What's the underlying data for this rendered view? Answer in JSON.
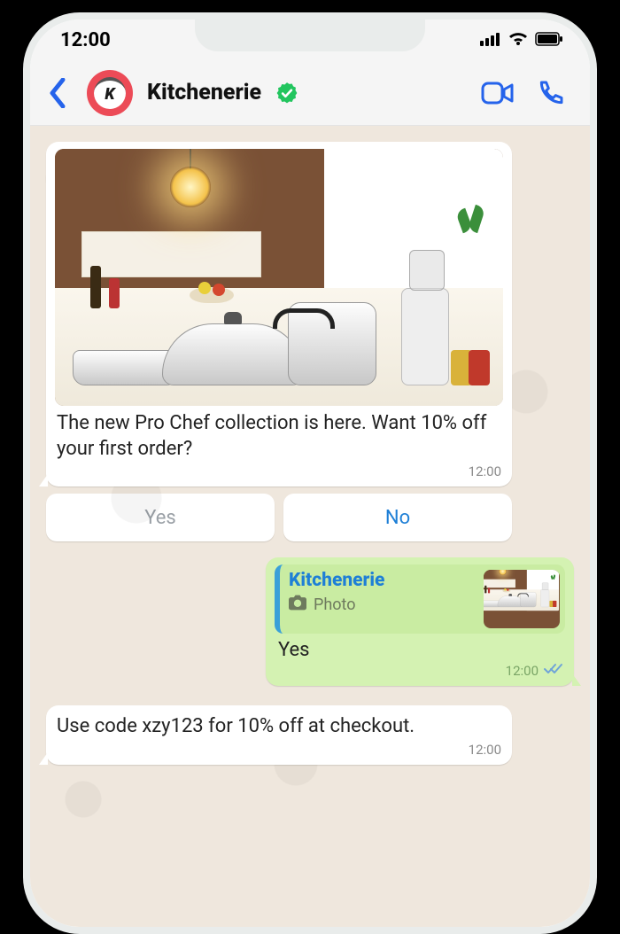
{
  "statusbar": {
    "time": "12:00"
  },
  "header": {
    "title": "Kitchenerie",
    "avatar_initial": "K"
  },
  "messages": {
    "promo": {
      "text": "The new Pro Chef collection is here. Want 10% off your first order?",
      "time": "12:00"
    },
    "quick_replies": {
      "yes": "Yes",
      "no": "No"
    },
    "user_reply": {
      "quoted_name": "Kitchenerie",
      "quoted_type": "Photo",
      "text": "Yes",
      "time": "12:00"
    },
    "followup": {
      "text": "Use code xzy123 for 10% off at checkout.",
      "time": "12:00"
    }
  }
}
